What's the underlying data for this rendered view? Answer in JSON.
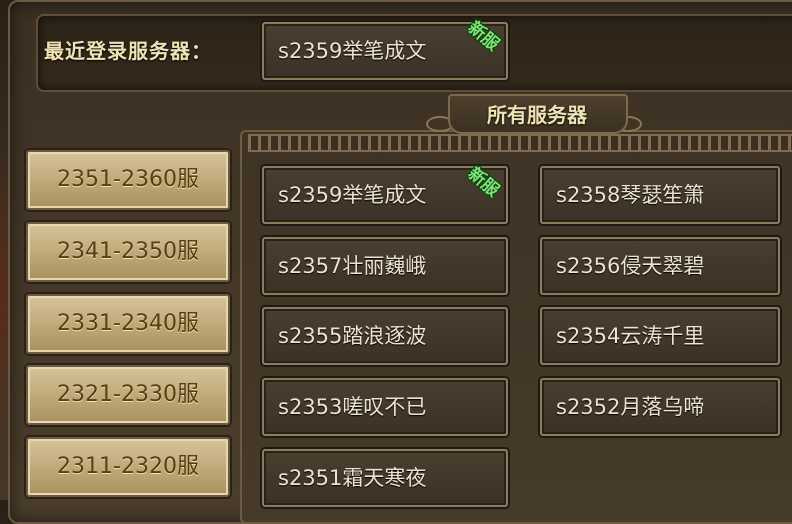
{
  "recent": {
    "label": "最近登录服务器：",
    "server": "s2359举笔成文",
    "badge": "新服"
  },
  "all_servers_title": "所有服务器",
  "ranges": [
    "2351-2360服",
    "2341-2350服",
    "2331-2340服",
    "2321-2330服",
    "2311-2320服"
  ],
  "servers": [
    {
      "name": "s2359举笔成文",
      "badge": "新服"
    },
    {
      "name": "s2358琴瑟笙箫"
    },
    {
      "name": "s2357壮丽巍峨"
    },
    {
      "name": "s2356侵天翠碧"
    },
    {
      "name": "s2355踏浪逐波"
    },
    {
      "name": "s2354云涛千里"
    },
    {
      "name": "s2353嗟叹不已"
    },
    {
      "name": "s2352月落乌啼"
    },
    {
      "name": "s2351霜天寒夜"
    }
  ]
}
